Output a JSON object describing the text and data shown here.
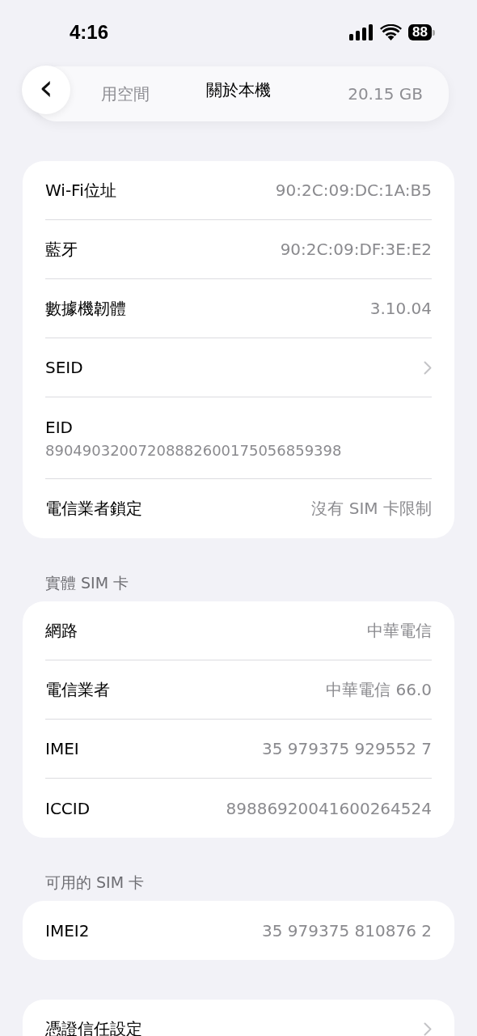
{
  "status_bar": {
    "time": "4:16",
    "battery": "88"
  },
  "background_card": {
    "label": "用空間",
    "value": "20.15 GB"
  },
  "nav": {
    "back": "‹",
    "title": "關於本機"
  },
  "sections": [
    {
      "rows": [
        {
          "kind": "value",
          "label": "Wi-Fi位址",
          "value": "90:2C:09:DC:1A:B5"
        },
        {
          "kind": "value",
          "label": "藍牙",
          "value": "90:2C:09:DF:3E:E2"
        },
        {
          "kind": "value",
          "label": "數據機韌體",
          "value": "3.10.04"
        },
        {
          "kind": "chevron",
          "label": "SEID"
        },
        {
          "kind": "stacked",
          "label": "EID",
          "value": "89049032007208882600175056859398"
        },
        {
          "kind": "value",
          "label": "電信業者鎖定",
          "value": "沒有 SIM 卡限制"
        }
      ]
    },
    {
      "header": "實體 SIM 卡",
      "rows": [
        {
          "kind": "value",
          "label": "網路",
          "value": "中華電信"
        },
        {
          "kind": "value",
          "label": "電信業者",
          "value": "中華電信 66.0"
        },
        {
          "kind": "value",
          "label": "IMEI",
          "value": "35 979375 929552 7"
        },
        {
          "kind": "value",
          "label": "ICCID",
          "value": "89886920041600264524"
        }
      ]
    },
    {
      "header": "可用的 SIM 卡",
      "rows": [
        {
          "kind": "value",
          "label": "IMEI2",
          "value": "35 979375 810876 2"
        }
      ]
    },
    {
      "rows": [
        {
          "kind": "chevron",
          "label": "憑證信任設定"
        }
      ]
    }
  ]
}
